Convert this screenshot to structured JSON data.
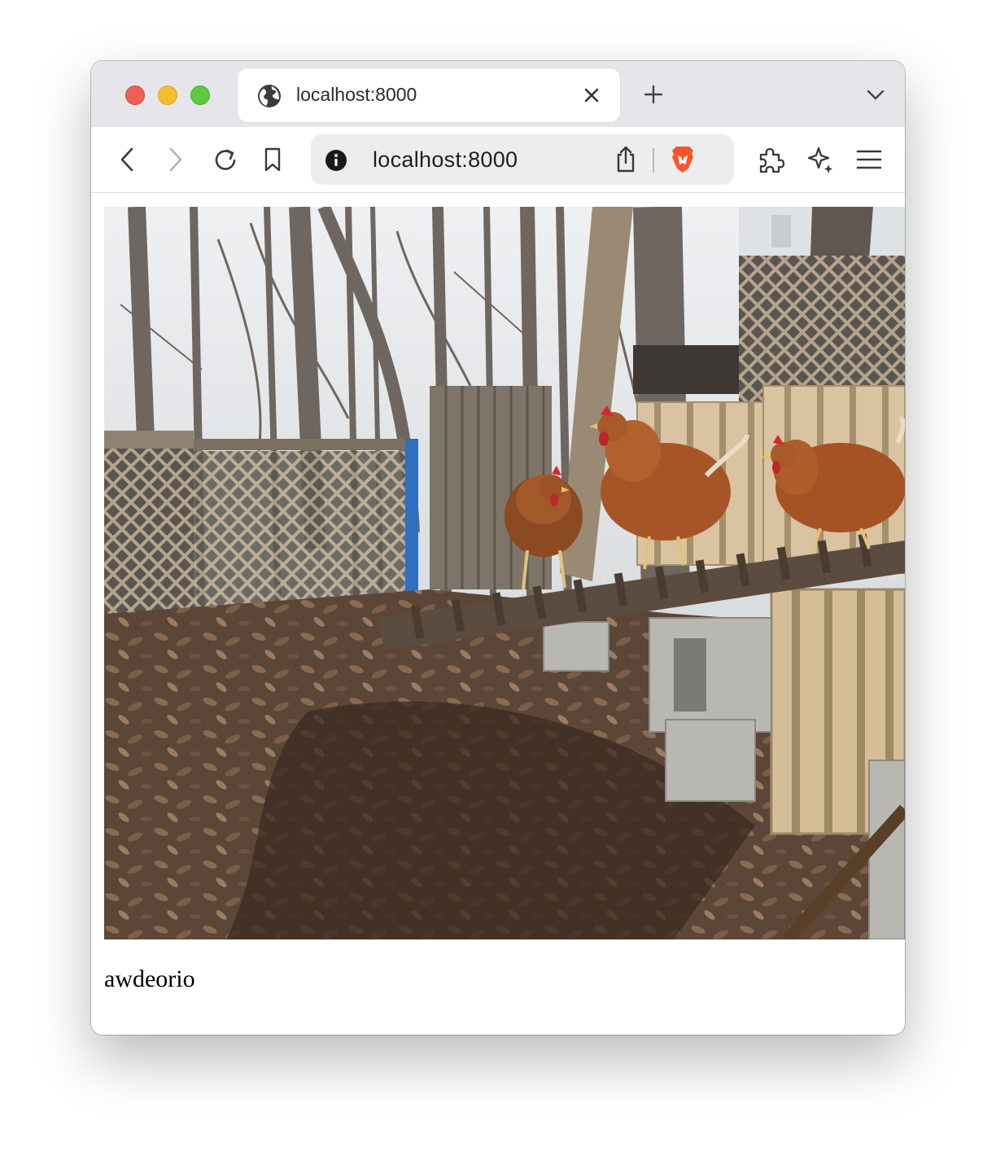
{
  "browser": {
    "tab": {
      "title": "localhost:8000",
      "icon": "globe-icon"
    },
    "address_bar": {
      "url": "localhost:8000",
      "site_info_icon": "info-icon"
    },
    "toolbar_icons": [
      "chevron-left-icon",
      "chevron-right-icon",
      "reload-icon",
      "bookmark-icon",
      "share-icon",
      "brave-shields-icon",
      "extensions-icon",
      "leo-ai-icon",
      "hamburger-menu-icon"
    ],
    "colors": {
      "close": "#ee5f57",
      "minimize": "#f6be2f",
      "maximize": "#5fc93f",
      "brave": "#fb542b"
    }
  },
  "page": {
    "image_subject": "Three brown hens standing on a wooden ramp in a leaf-covered backyard with fence, pallets and cinder blocks",
    "caption": "awdeorio"
  }
}
